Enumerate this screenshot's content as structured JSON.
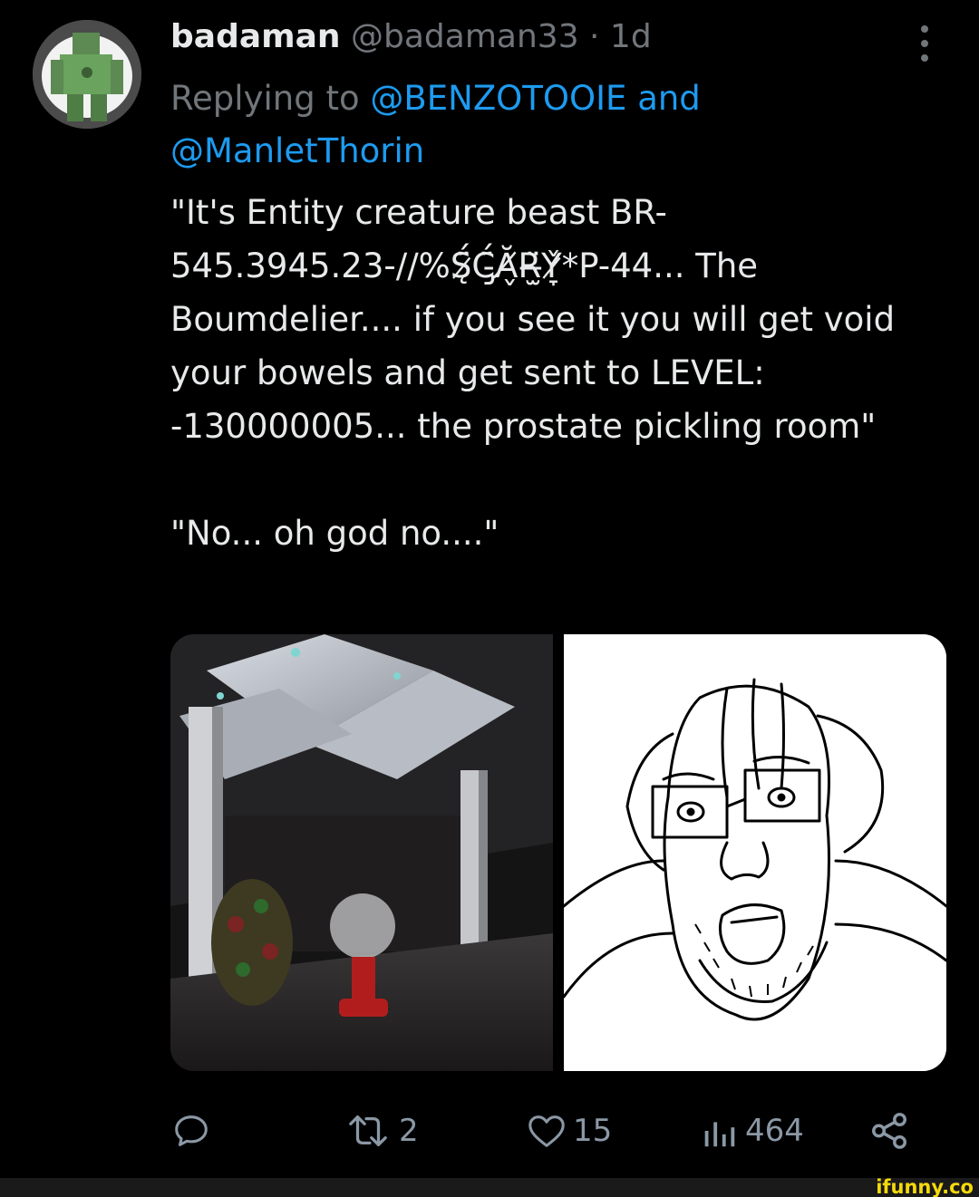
{
  "tweet": {
    "author": {
      "display_name": "badaman",
      "handle_time": "@badaman33 · 1d"
    },
    "reply": {
      "prefix": "Replying to",
      "mention_1": "@BENZOTOOIE",
      "conjunction": "and",
      "mention_2": "@ManletThorin"
    },
    "text": "\"It's Entity creature beast BR-545.3945.23-//%S̷̨̈́C̵̡̈́Ă̸̬R̶̫̈Y̷̞̌*P-44... The Boumdelier.... if you see it you will get void your bowels and get sent to LEVEL: -130000005... the prostate pickling room\"\n\n\"No... oh god no....\"",
    "metrics": {
      "retweets": "2",
      "likes": "15",
      "views": "464"
    }
  },
  "icons": {
    "more": "more-vertical-icon",
    "reply": "speech-bubble-icon",
    "retweet": "retweet-icon",
    "like": "heart-icon",
    "views": "bar-chart-icon",
    "share": "share-nodes-icon"
  },
  "colors": {
    "background": "#000000",
    "text": "#e7e9ea",
    "muted": "#71767b",
    "link": "#1d9bf0",
    "watermark": "#f5d90a"
  },
  "watermark": "ifunny.co"
}
